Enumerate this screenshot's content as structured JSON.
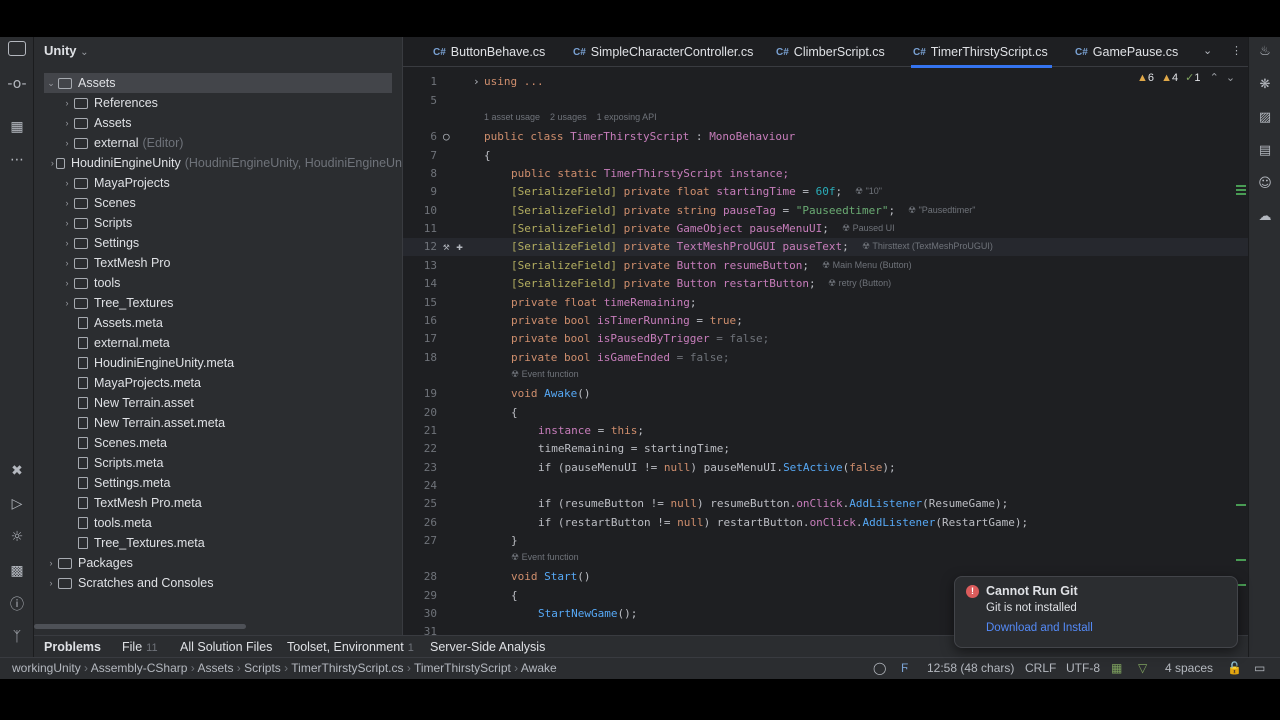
{
  "project": {
    "title": "Unity"
  },
  "tree": [
    {
      "label": "Assets",
      "kind": "folder",
      "depth": 0,
      "expanded": true,
      "selected": true
    },
    {
      "label": "References",
      "kind": "folder",
      "depth": 1
    },
    {
      "label": "Assets",
      "kind": "folder",
      "depth": 1
    },
    {
      "label": "external",
      "extra": "(Editor)",
      "kind": "folder",
      "depth": 1
    },
    {
      "label": "HoudiniEngineUnity",
      "extra": "(HoudiniEngineUnity, HoudiniEngineUn",
      "kind": "folder",
      "depth": 1
    },
    {
      "label": "MayaProjects",
      "kind": "folder",
      "depth": 1
    },
    {
      "label": "Scenes",
      "kind": "folder",
      "depth": 1
    },
    {
      "label": "Scripts",
      "kind": "folder",
      "depth": 1
    },
    {
      "label": "Settings",
      "kind": "folder",
      "depth": 1
    },
    {
      "label": "TextMesh Pro",
      "kind": "folder",
      "depth": 1
    },
    {
      "label": "tools",
      "kind": "folder",
      "depth": 1
    },
    {
      "label": "Tree_Textures",
      "kind": "folder",
      "depth": 1
    },
    {
      "label": "Assets.meta",
      "kind": "file",
      "depth": 1
    },
    {
      "label": "external.meta",
      "kind": "file",
      "depth": 1
    },
    {
      "label": "HoudiniEngineUnity.meta",
      "kind": "file",
      "depth": 1
    },
    {
      "label": "MayaProjects.meta",
      "kind": "file",
      "depth": 1
    },
    {
      "label": "New Terrain.asset",
      "kind": "file",
      "depth": 1
    },
    {
      "label": "New Terrain.asset.meta",
      "kind": "file",
      "depth": 1
    },
    {
      "label": "Scenes.meta",
      "kind": "file",
      "depth": 1
    },
    {
      "label": "Scripts.meta",
      "kind": "file",
      "depth": 1
    },
    {
      "label": "Settings.meta",
      "kind": "file",
      "depth": 1
    },
    {
      "label": "TextMesh Pro.meta",
      "kind": "file",
      "depth": 1
    },
    {
      "label": "tools.meta",
      "kind": "file",
      "depth": 1
    },
    {
      "label": "Tree_Textures.meta",
      "kind": "file",
      "depth": 1
    },
    {
      "label": "Packages",
      "kind": "folder",
      "depth": 0
    },
    {
      "label": "Scratches and Consoles",
      "kind": "folder",
      "depth": 0
    }
  ],
  "tabs": [
    {
      "label": "ButtonBehave.cs",
      "active": false
    },
    {
      "label": "SimpleCharacterController.cs",
      "active": false
    },
    {
      "label": "ClimberScript.cs",
      "active": false
    },
    {
      "label": "TimerThirstyScript.cs",
      "active": true
    },
    {
      "label": "GamePause.cs",
      "active": false
    }
  ],
  "tab_prefix": "C#",
  "inspections": {
    "warnings": "6",
    "weak": "4",
    "typos": "1"
  },
  "code_meta": {
    "usages": "1 asset usage",
    "refs": "2 usages",
    "api": "1 exposing API",
    "event1": "Event function",
    "event2": "Event function"
  },
  "code": {
    "l1": "using ...",
    "l6a": "public class ",
    "l6b": "TimerThirstyScript",
    "l6c": " : ",
    "l6d": "MonoBehaviour",
    "l7": "{",
    "l8a": "public static ",
    "l8b": "TimerThirstyScript",
    "l8c": " instance;",
    "l9a": "[SerializeField]",
    "l9b": " private float ",
    "l9c": "startingTime",
    "l9d": " = ",
    "l9e": "60f",
    "l9f": ";",
    "l9h": "\"10\"",
    "l10a": "[SerializeField]",
    "l10b": " private string ",
    "l10c": "pauseTag",
    "l10d": " = ",
    "l10e": "\"Pauseedtimer\"",
    "l10f": ";",
    "l10h": "\"Pausedtimer\"",
    "l11a": "[SerializeField]",
    "l11b": " private ",
    "l11c": "GameObject",
    "l11d": " pauseMenuUI",
    "l11e": ";",
    "l11h": "Paused UI",
    "l12a": "[SerializeField]",
    "l12b": " private ",
    "l12c": "TextMeshProUGUI",
    "l12d": " pauseText",
    "l12e": ";",
    "l12h": "Thirsttext (TextMeshProUGUI)",
    "l13a": "[SerializeField]",
    "l13b": " private ",
    "l13c": "Button",
    "l13d": " resumeButton",
    "l13e": ";",
    "l13h": "Main Menu (Button)",
    "l14a": "[SerializeField]",
    "l14b": " private ",
    "l14c": "Button",
    "l14d": " restartButton",
    "l14e": ";",
    "l14h": "retry (Button)",
    "l15a": "private float ",
    "l15b": "timeRemaining",
    "l15c": ";",
    "l16a": "private bool ",
    "l16b": "isTimerRunning",
    "l16c": " = ",
    "l16d": "true",
    "l16e": ";",
    "l17a": "private bool ",
    "l17b": "isPausedByTrigger",
    "l17c": " = false;",
    "l18a": "private bool ",
    "l18b": "isGameEnded",
    "l18c": " = false;",
    "l19a": "void ",
    "l19b": "Awake",
    "l19c": "()",
    "l20": "{",
    "l21a": "instance",
    "l21b": " = ",
    "l21c": "this",
    "l21d": ";",
    "l22": "timeRemaining = startingTime;",
    "l23a": "if (pauseMenuUI ",
    "l23b": "!= ",
    "l23c": "null",
    "l23d": ") pauseMenuUI.",
    "l23e": "SetActive",
    "l23f": "(",
    "l23g": "false",
    "l23h": ");",
    "l25a": "if (resumeButton ",
    "l25b": "!= ",
    "l25c": "null",
    "l25d": ") resumeButton.",
    "l25e": "onClick",
    "l25f": ".",
    "l25g": "AddListener",
    "l25h": "(ResumeGame);",
    "l26a": "if (restartButton ",
    "l26b": "!= ",
    "l26c": "null",
    "l26d": ") restartButton.",
    "l26e": "onClick",
    "l26f": ".",
    "l26g": "AddListener",
    "l26h": "(RestartGame);",
    "l27": "}",
    "l28a": "void ",
    "l28b": "Start",
    "l28c": "()",
    "l29": "{",
    "l30a": "StartNewGame",
    "l30b": "();"
  },
  "line_numbers": [
    "1",
    "5",
    "6",
    "7",
    "8",
    "9",
    "10",
    "11",
    "12",
    "13",
    "14",
    "15",
    "16",
    "17",
    "18",
    "19",
    "20",
    "21",
    "22",
    "23",
    "24",
    "25",
    "26",
    "27",
    "28",
    "29",
    "30",
    "31"
  ],
  "problems": [
    {
      "label": "Problems",
      "count": ""
    },
    {
      "label": "File",
      "count": "11"
    },
    {
      "label": "All Solution Files",
      "count": ""
    },
    {
      "label": "Toolset, Environment",
      "count": "1"
    },
    {
      "label": "Server-Side Analysis",
      "count": ""
    }
  ],
  "breadcrumb": [
    "workingUnity",
    "Assembly-CSharp",
    "Assets",
    "Scripts",
    "TimerThirstyScript.cs",
    "TimerThirstyScript",
    "Awake"
  ],
  "status": {
    "position": "12:58 (48 chars)",
    "line_sep": "CRLF",
    "encoding": "UTF-8",
    "indent": "4 spaces"
  },
  "notification": {
    "title": "Cannot Run Git",
    "message": "Git is not installed",
    "action": "Download and Install"
  },
  "colors": {
    "accent": "#3574f0",
    "error": "#db5c5c",
    "link": "#548af7"
  }
}
